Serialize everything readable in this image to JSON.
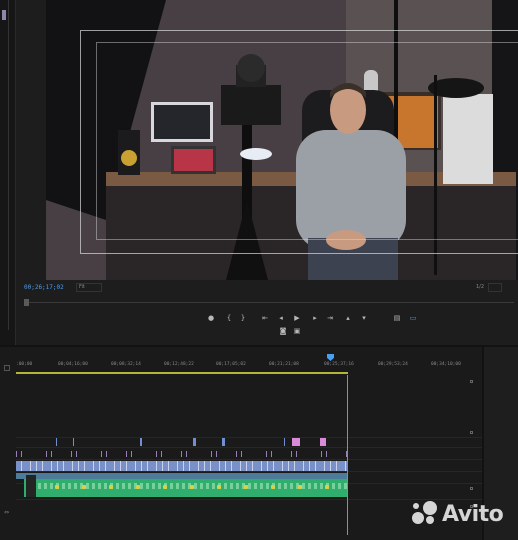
{
  "monitor": {
    "timecode": "00;26;17;02",
    "fit_label": "Fit",
    "resolution": "1/2"
  },
  "transport": {
    "buttons": [
      {
        "name": "add-marker-icon",
        "glyph": "●"
      },
      {
        "name": "mark-in-icon",
        "glyph": "{"
      },
      {
        "name": "mark-out-icon",
        "glyph": "}"
      },
      {
        "name": "go-to-in-icon",
        "glyph": "⇤"
      },
      {
        "name": "step-back-icon",
        "glyph": "◂"
      },
      {
        "name": "play-icon",
        "glyph": "▶"
      },
      {
        "name": "step-forward-icon",
        "glyph": "▸"
      },
      {
        "name": "go-to-out-icon",
        "glyph": "⇥"
      },
      {
        "name": "lift-icon",
        "glyph": "▴"
      },
      {
        "name": "extract-icon",
        "glyph": "▾"
      },
      {
        "name": "export-frame-icon",
        "glyph": "◙"
      },
      {
        "name": "comparison-view-icon",
        "glyph": "▣"
      },
      {
        "name": "proxy-toggle-icon",
        "glyph": "▤"
      },
      {
        "name": "button-editor-icon",
        "glyph": "▭"
      }
    ]
  },
  "timeline": {
    "ruler_labels": [
      ":00;00",
      "00;04;16;00",
      "00;08;32;14",
      "00;12;48;22",
      "00;17;05;02",
      "00;21;21;08",
      "00;25;37;16",
      "00;29;53;24",
      "00;34;10;00"
    ]
  },
  "watermark": {
    "text": "Avito"
  },
  "colors": {
    "playhead": "#4b9ef0",
    "video_clip": "#7a90c8",
    "audio_clip": "#2fae6e",
    "marker_pink": "#d98ad8",
    "marker_blue": "#6e8fd0",
    "work_area": "#b5b537"
  }
}
